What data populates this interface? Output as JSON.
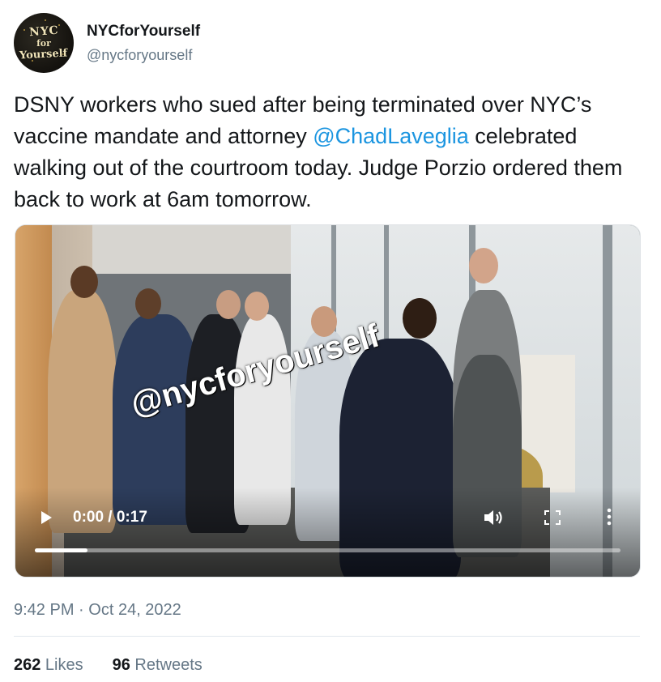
{
  "author": {
    "display_name": "NYCforYourself",
    "handle": "@nycforyourself",
    "avatar_lines": [
      "NYC",
      "for",
      "Yourself"
    ]
  },
  "tweet": {
    "text_before": "DSNY workers who sued after being terminated over NYC’s vaccine mandate and attorney ",
    "mention": "@ChadLaveglia",
    "text_after": " celebrated walking out of the courtroom today. Judge Porzio ordered them back to work at 6am tomorrow."
  },
  "video": {
    "watermark": "@nycforyourself",
    "time": "0:00 / 0:17",
    "progress_fraction": 0.09,
    "icons": [
      "play-icon",
      "volume-icon",
      "fullscreen-icon",
      "more-options-icon"
    ]
  },
  "meta": {
    "time": "9:42 PM",
    "separator": "·",
    "date": "Oct 24, 2022"
  },
  "stats": {
    "likes_count": "262",
    "likes_label": " Likes",
    "retweets_count": "96",
    "retweets_label": " Retweets"
  },
  "colors": {
    "mention": "#1b95e0",
    "secondary_text": "#657786",
    "primary_text": "#14171a"
  }
}
